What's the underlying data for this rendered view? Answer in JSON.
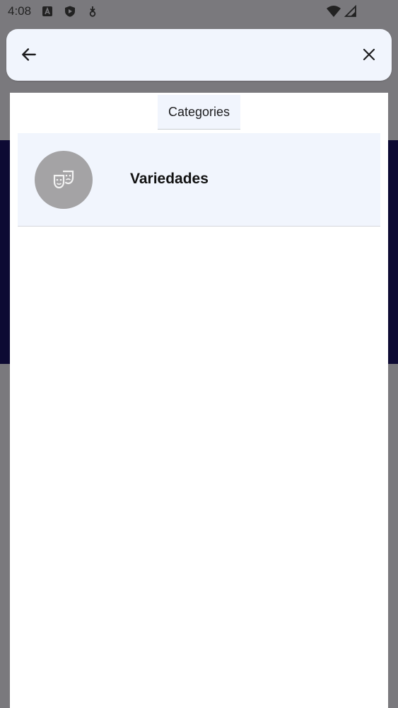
{
  "status_bar": {
    "time": "4:08",
    "left_icons": [
      "text-a-icon",
      "shield-icon",
      "download-icon"
    ],
    "right_icons": [
      "wifi-icon",
      "signal-icon"
    ]
  },
  "search": {
    "value": "",
    "placeholder": "",
    "back_icon": "arrow-back-icon",
    "clear_icon": "close-icon"
  },
  "tabs": [
    {
      "label": "Categories",
      "selected": true
    }
  ],
  "categories": [
    {
      "name": "Variedades",
      "icon": "theater-masks-icon"
    }
  ],
  "colors": {
    "search_bg": "#f1f5fd",
    "row_bg": "#f1f5fd",
    "avatar_bg": "#a4a3a5",
    "scrim": "#7a797d"
  }
}
